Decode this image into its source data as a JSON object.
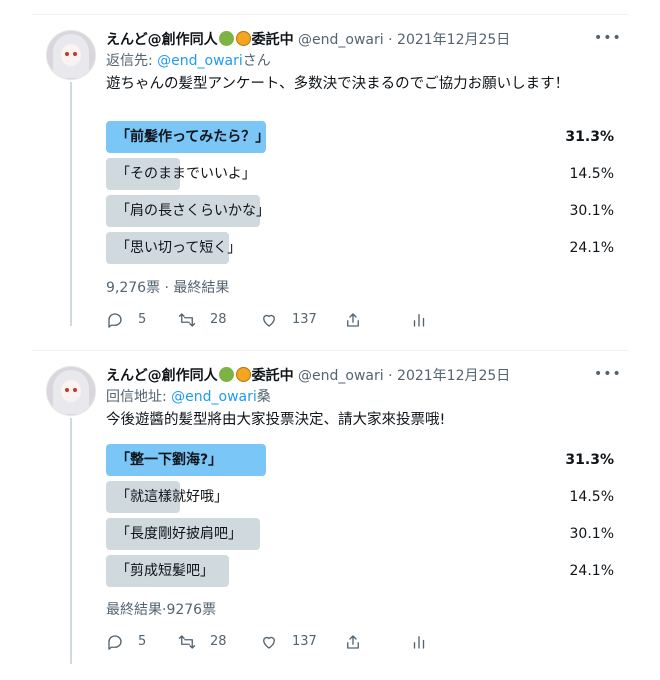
{
  "tweets": [
    {
      "author": {
        "name": "えんど@創作同人",
        "badge": "委託中",
        "handle": "@end_owari",
        "date": "2021年12月25日"
      },
      "reply": {
        "prefix": "返信先: ",
        "handle": "@end_owari",
        "suffix": "さん"
      },
      "text": "遊ちゃんの髪型アンケート、多数決で決まるのでご協力お願いします！",
      "poll": [
        {
          "label": "「前髪作ってみたら？」",
          "pct": "31.3%",
          "fraction": 0.313,
          "winner": true
        },
        {
          "label": "「そのままでいいよ」",
          "pct": "14.5%",
          "fraction": 0.145,
          "winner": false
        },
        {
          "label": "「肩の長さくらいかな」",
          "pct": "30.1%",
          "fraction": 0.301,
          "winner": false
        },
        {
          "label": "「思い切って短く」",
          "pct": "24.1%",
          "fraction": 0.241,
          "winner": false
        }
      ],
      "meta": "9,276票 · 最終結果",
      "actions": {
        "replies": "5",
        "retweets": "28",
        "likes": "137"
      }
    },
    {
      "author": {
        "name": "えんど@創作同人",
        "badge": "委託中",
        "handle": "@end_owari",
        "date": "2021年12月25日"
      },
      "reply": {
        "prefix": "回信地址: ",
        "handle": "@end_owari",
        "suffix": "桑"
      },
      "text": "今後遊醬的髪型將由大家投票決定、請大家來投票哦!",
      "poll": [
        {
          "label": "「整一下劉海?」",
          "pct": "31.3%",
          "fraction": 0.313,
          "winner": true
        },
        {
          "label": "「就這樣就好哦」",
          "pct": "14.5%",
          "fraction": 0.145,
          "winner": false
        },
        {
          "label": "「長度剛好披肩吧」",
          "pct": "30.1%",
          "fraction": 0.301,
          "winner": false
        },
        {
          "label": "「剪成短髪吧」",
          "pct": "24.1%",
          "fraction": 0.241,
          "winner": false
        }
      ],
      "meta": "最終結果·9276票",
      "actions": {
        "replies": "5",
        "retweets": "28",
        "likes": "137"
      }
    }
  ],
  "icons": [
    "more-icon",
    "reply-icon",
    "retweet-icon",
    "like-icon",
    "share-icon",
    "analytics-icon",
    "leaf-emoji-icon",
    "tiger-emoji-icon"
  ],
  "colors": {
    "winner_bar": "#79c6f7",
    "other_bar": "#cfd9de",
    "link": "#1d9bf0",
    "muted": "#536471"
  }
}
